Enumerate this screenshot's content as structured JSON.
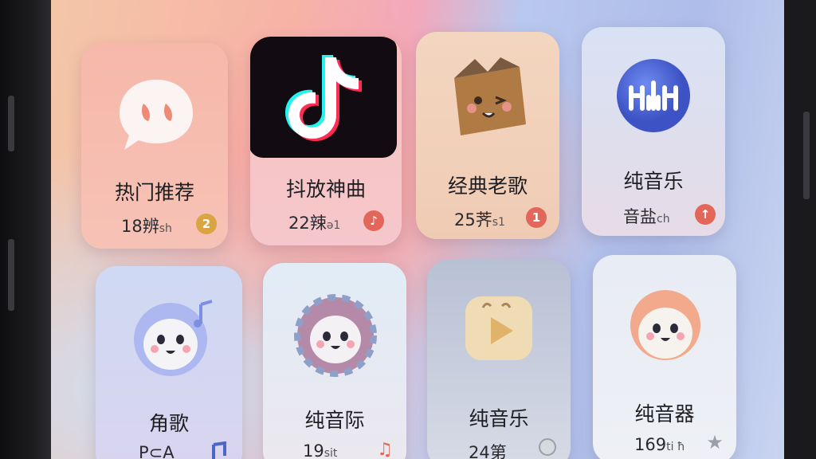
{
  "tiles": [
    {
      "title": "热门推荐",
      "count": "18辨",
      "suffix": "sh",
      "badge": "2",
      "icon": "chat-bubble-icon"
    },
    {
      "title": "抖放神曲",
      "count": "22辣",
      "suffix": "ə1",
      "badge": "♪",
      "icon": "tiktok-logo-icon"
    },
    {
      "title": "经典老歌",
      "count": "25荠",
      "suffix": "s1",
      "badge": "1",
      "icon": "wooden-box-character-icon"
    },
    {
      "title": "纯音乐",
      "count": "音盐",
      "suffix": "ch",
      "badge": "↑",
      "icon": "waveform-logo-icon"
    },
    {
      "title": "角歌",
      "count": "P⊂A",
      "suffix": "",
      "badge": "",
      "icon": "blue-character-icon"
    },
    {
      "title": "纯音际",
      "count": "19",
      "suffix": "sit",
      "badge": "♫",
      "icon": "striped-hood-character-icon"
    },
    {
      "title": "纯音乐",
      "count": "24第",
      "suffix": "",
      "badge": "",
      "icon": "play-button-icon"
    },
    {
      "title": "纯音器",
      "count": "169",
      "suffix": "ti ħ",
      "badge": "★",
      "icon": "peach-character-icon"
    }
  ],
  "colors": {
    "badge_gold": "#d9a441",
    "badge_red": "#e2675a",
    "badge_grey": "#9aa0aa"
  }
}
